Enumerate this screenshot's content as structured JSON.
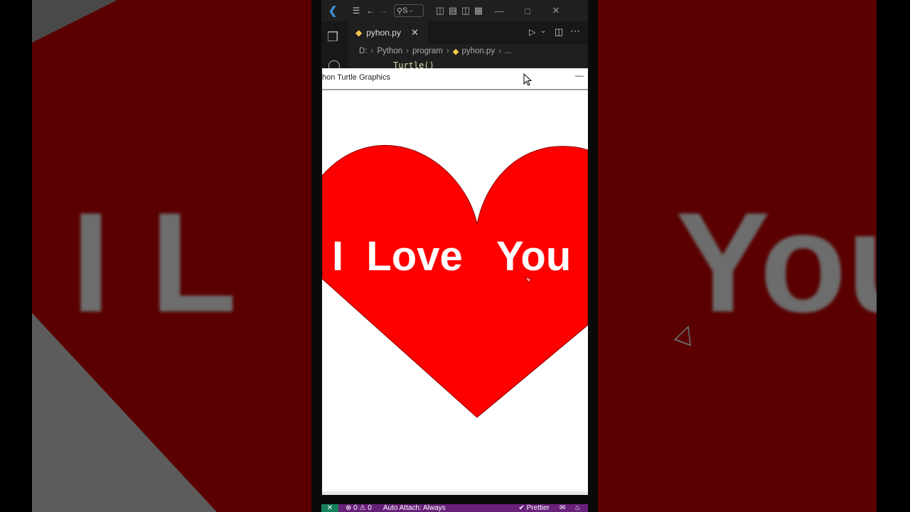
{
  "background": {
    "left_text": "I L",
    "right_text": "You"
  },
  "vscode": {
    "search_label": "S",
    "tab": {
      "filename": "pyhon.py"
    },
    "breadcrumb": [
      "D:",
      "Python",
      "program",
      "pyhon.py",
      "..."
    ],
    "code_line": "Turtle()"
  },
  "turtle_window": {
    "title": "hon Turtle Graphics",
    "heart_text": "I  Love   You",
    "heart_color": "#ff0000"
  },
  "statusbar": {
    "problems": "0 ⚠ 0",
    "auto_attach": "Auto Attach: Always",
    "prettier": "✔ Prettier"
  }
}
